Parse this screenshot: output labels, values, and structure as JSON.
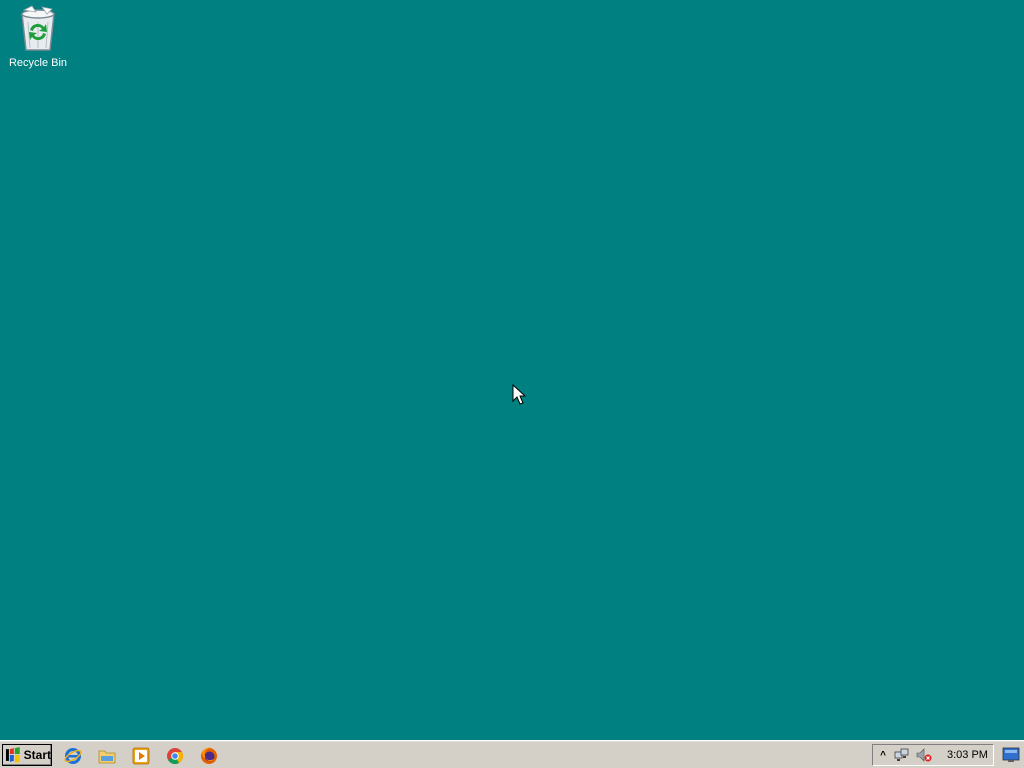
{
  "desktop": {
    "background_color": "#008080",
    "icons": [
      {
        "label": "Recycle Bin",
        "icon": "recycle-bin-icon"
      }
    ]
  },
  "taskbar": {
    "start_label": "Start",
    "quicklaunch": [
      {
        "name": "internet-explorer",
        "icon": "internet-explorer-icon"
      },
      {
        "name": "file-explorer",
        "icon": "folder-icon"
      },
      {
        "name": "media-player",
        "icon": "media-player-icon"
      },
      {
        "name": "chrome",
        "icon": "chrome-icon"
      },
      {
        "name": "firefox",
        "icon": "firefox-icon"
      }
    ],
    "tray": {
      "toggle_glyph": "^",
      "icons": [
        "network-icon",
        "volume-muted-icon"
      ],
      "clock": "3:03 PM"
    },
    "show_desktop_icon": "show-desktop-icon"
  }
}
